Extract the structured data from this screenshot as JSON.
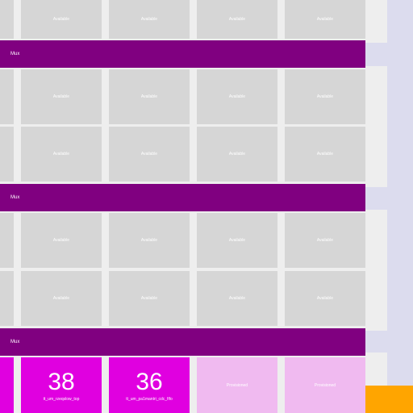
{
  "mux_label": "Mux",
  "status": {
    "available": "Available",
    "provisioned": "Provisioned"
  },
  "slots": [
    {
      "value": "38",
      "name": "tt_um_rzeqslow_top"
    },
    {
      "value": "36",
      "name": "tt_um_pa1mantri_cdc_fifo"
    }
  ],
  "colors": {
    "page": "#dcdcee",
    "panel": "#eeeeee",
    "mux": "#800080",
    "available": "#d6d6d6",
    "used": "#e000e0",
    "provisioned": "#f0baf0",
    "corner": "#ffa500"
  }
}
